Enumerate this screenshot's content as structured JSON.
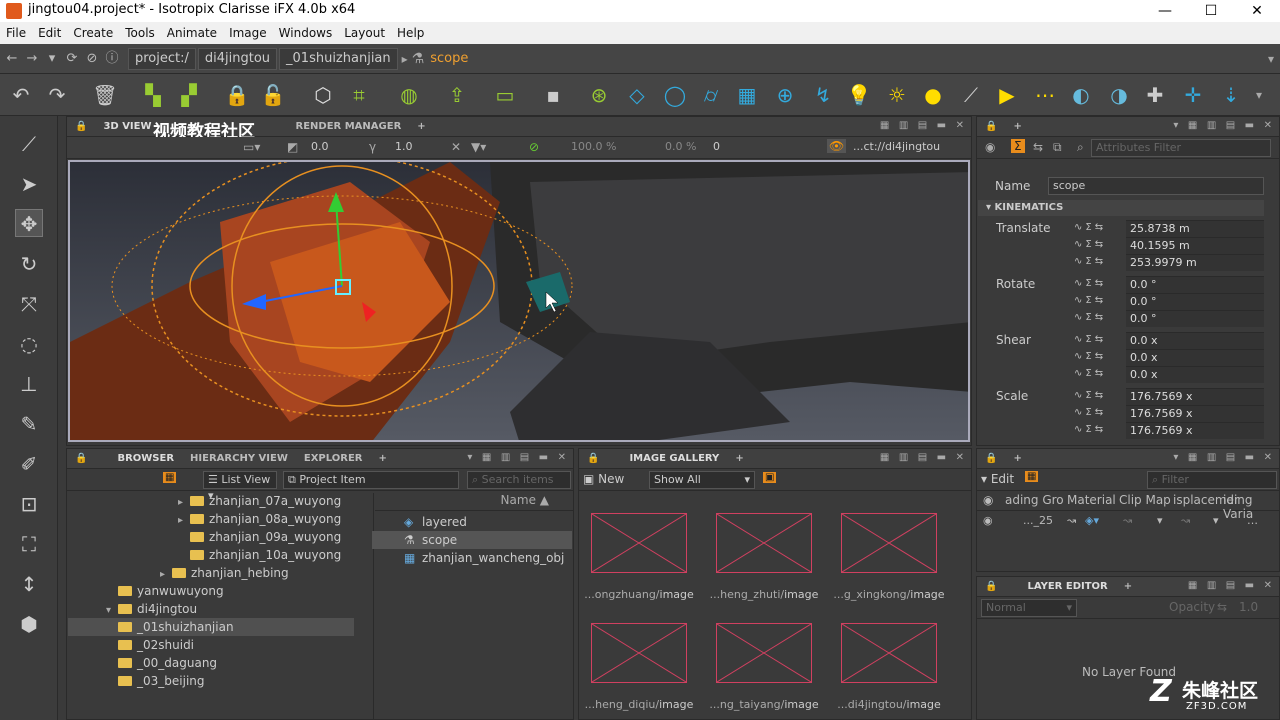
{
  "window": {
    "title": "jingtou04.project* - Isotropix Clarisse iFX 4.0b x64",
    "minimize": "—",
    "maximize": "☐",
    "close": "✕"
  },
  "menu": [
    "File",
    "Edit",
    "Create",
    "Tools",
    "Animate",
    "Image",
    "Windows",
    "Layout",
    "Help"
  ],
  "path": {
    "crumbs": [
      "project:/",
      "di4jingtou",
      "_01shuizhanjian"
    ],
    "current": "scope"
  },
  "viewport_header": {
    "tabs": [
      "3D VIEW",
      "RENDER MANAGER"
    ],
    "watermark": "视频教程社区",
    "exposure": "0.0",
    "gamma": "1.0",
    "zoom": "100.0 %",
    "pct2": "0.0 %",
    "frame": "0",
    "context": "...ct://di4jingtou"
  },
  "attributes": {
    "filter_placeholder": "Attributes Filter",
    "name_label": "Name",
    "name_value": "scope",
    "section": "KINEMATICS",
    "translate": {
      "label": "Translate",
      "values": [
        "25.8738 m",
        "40.1595 m",
        "253.9979 m"
      ]
    },
    "rotate": {
      "label": "Rotate",
      "values": [
        "0.0 °",
        "0.0 °",
        "0.0 °"
      ]
    },
    "shear": {
      "label": "Shear",
      "values": [
        "0.0 x",
        "0.0 x",
        "0.0 x"
      ]
    },
    "scale": {
      "label": "Scale",
      "values": [
        "176.7569 x",
        "176.7569 x",
        "176.7569 x"
      ]
    }
  },
  "browser": {
    "tabs": [
      "BROWSER",
      "HIERARCHY VIEW",
      "EXPLORER"
    ],
    "view_mode": "List View",
    "item_filter": "Project Item",
    "search_placeholder": "Search items",
    "column": "Name ▲",
    "tree": [
      {
        "label": "zhanjian_07a_wuyong",
        "depth": 3,
        "arrow": "▸"
      },
      {
        "label": "zhanjian_08a_wuyong",
        "depth": 3,
        "arrow": "▸"
      },
      {
        "label": "zhanjian_09a_wuyong",
        "depth": 3,
        "arrow": ""
      },
      {
        "label": "zhanjian_10a_wuyong",
        "depth": 3,
        "arrow": ""
      },
      {
        "label": "zhanjian_hebing",
        "depth": 2,
        "arrow": "▸"
      },
      {
        "label": "yanwuwuyong",
        "depth": 1,
        "arrow": ""
      },
      {
        "label": "di4jingtou",
        "depth": 1,
        "arrow": "▾"
      },
      {
        "label": "_01shuizhanjian",
        "depth": 2,
        "arrow": ""
      },
      {
        "label": "_02shuidi",
        "depth": 2,
        "arrow": ""
      },
      {
        "label": "_00_daguang",
        "depth": 2,
        "arrow": ""
      },
      {
        "label": "_03_beijing",
        "depth": 2,
        "arrow": ""
      }
    ],
    "items": [
      "layered",
      "scope",
      "zhanjian_wancheng_obj"
    ]
  },
  "gallery": {
    "tab": "IMAGE GALLERY",
    "new_label": "New",
    "show": "Show All",
    "thumbs": [
      {
        "prefix": "...ongzhuang/",
        "suffix": "image"
      },
      {
        "prefix": "...heng_zhuti/",
        "suffix": "image"
      },
      {
        "prefix": "...g_xingkong/",
        "suffix": "image"
      },
      {
        "prefix": "...heng_diqiu/",
        "suffix": "image"
      },
      {
        "prefix": "...ng_taiyang/",
        "suffix": "image"
      },
      {
        "prefix": "...di4jingtou/",
        "suffix": "image"
      }
    ]
  },
  "material_panel": {
    "edit": "Edit",
    "filter_placeholder": "Filter",
    "columns": [
      "ading Gro",
      "Material",
      "Clip Map",
      "isplacemer",
      "iding Varia"
    ],
    "row_value": "..._25"
  },
  "layer_editor": {
    "tab": "LAYER EDITOR",
    "blend": "Normal",
    "opacity_label": "Opacity",
    "opacity": "1.0",
    "empty": "No Layer Found"
  },
  "brand": {
    "name": "朱峰社区",
    "url": "ZF3D.COM"
  }
}
